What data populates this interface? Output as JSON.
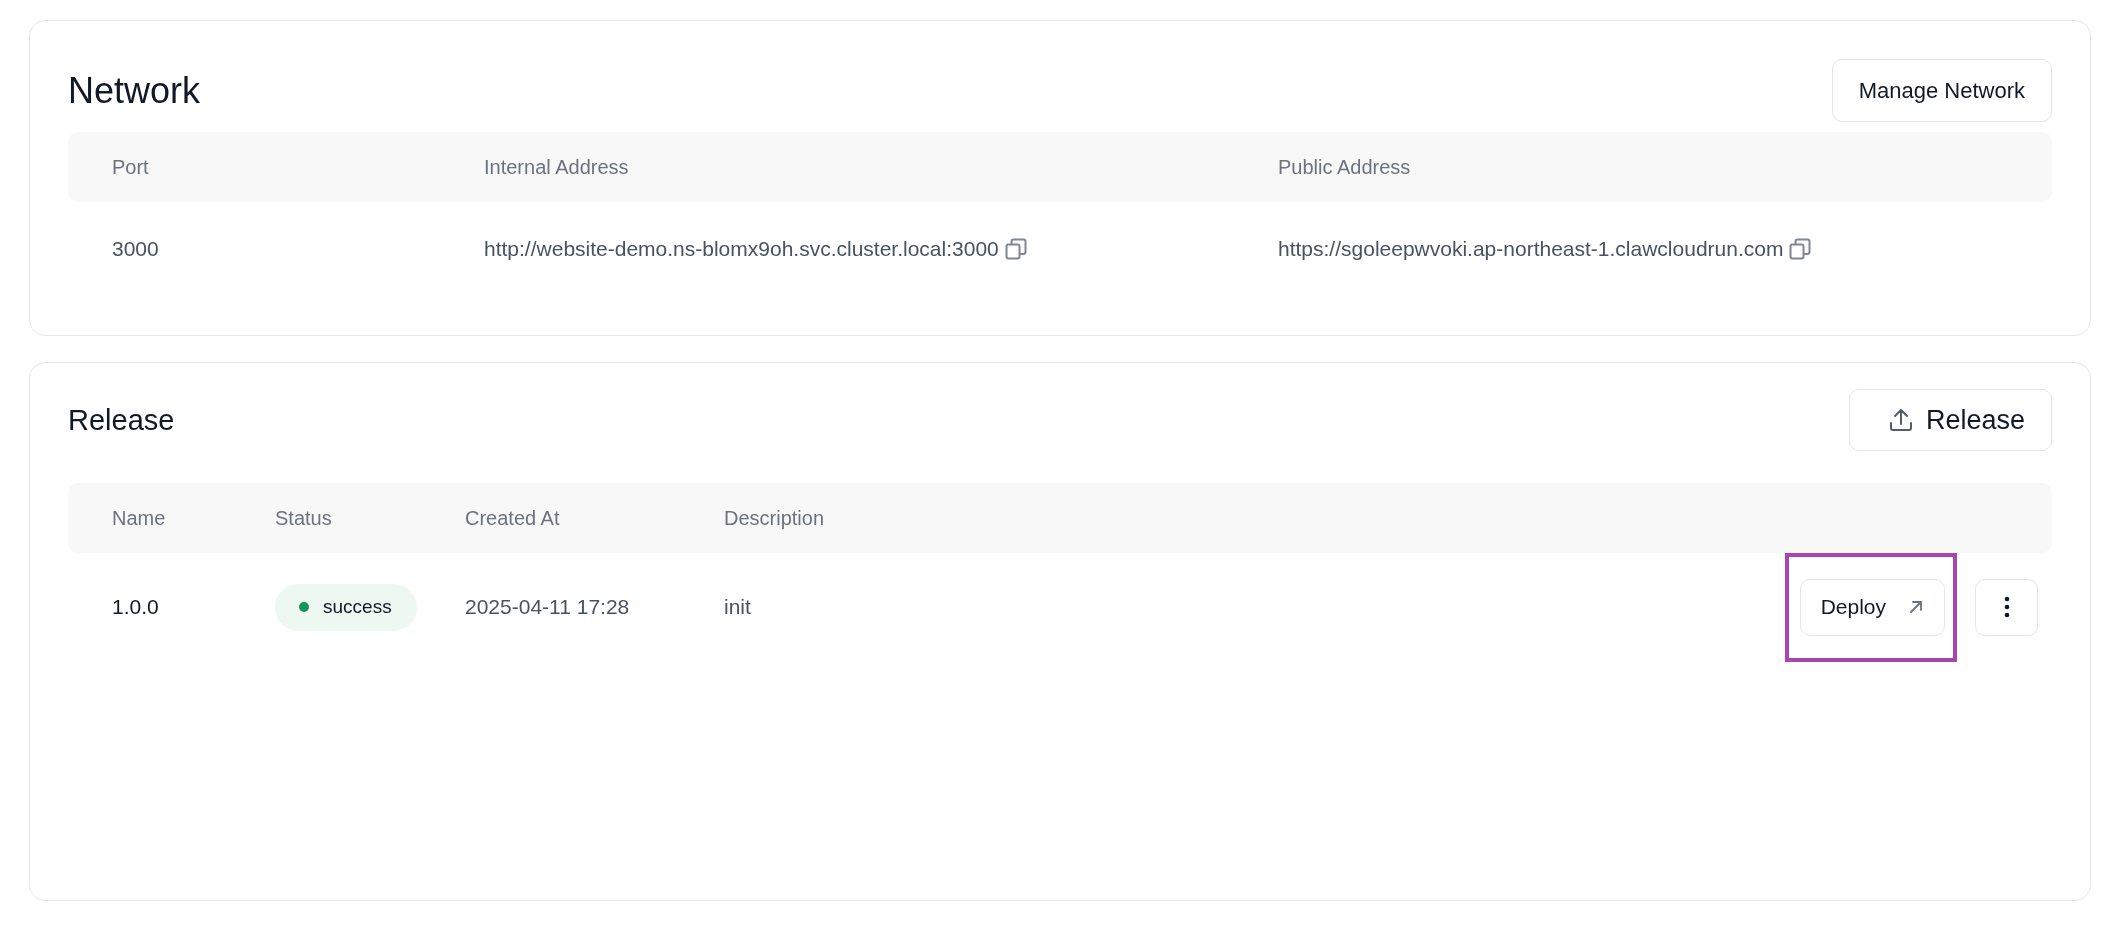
{
  "network": {
    "title": "Network",
    "manage_button": "Manage Network",
    "columns": [
      "Port",
      "Internal Address",
      "Public Address"
    ],
    "rows": [
      {
        "port": "3000",
        "internal": "http://website-demo.ns-blomx9oh.svc.cluster.local:3000",
        "public": "https://sgoleepwvoki.ap-northeast-1.clawcloudrun.com"
      }
    ]
  },
  "release": {
    "title": "Release",
    "release_button": "Release",
    "columns": [
      "Name",
      "Status",
      "Created At",
      "Description"
    ],
    "rows": [
      {
        "name": "1.0.0",
        "status": "success",
        "color": "#12955a",
        "created_at": "2025-04-11 17:28",
        "description": "init",
        "deploy_button": "Deploy",
        "deploy_highlighted": true
      }
    ]
  }
}
